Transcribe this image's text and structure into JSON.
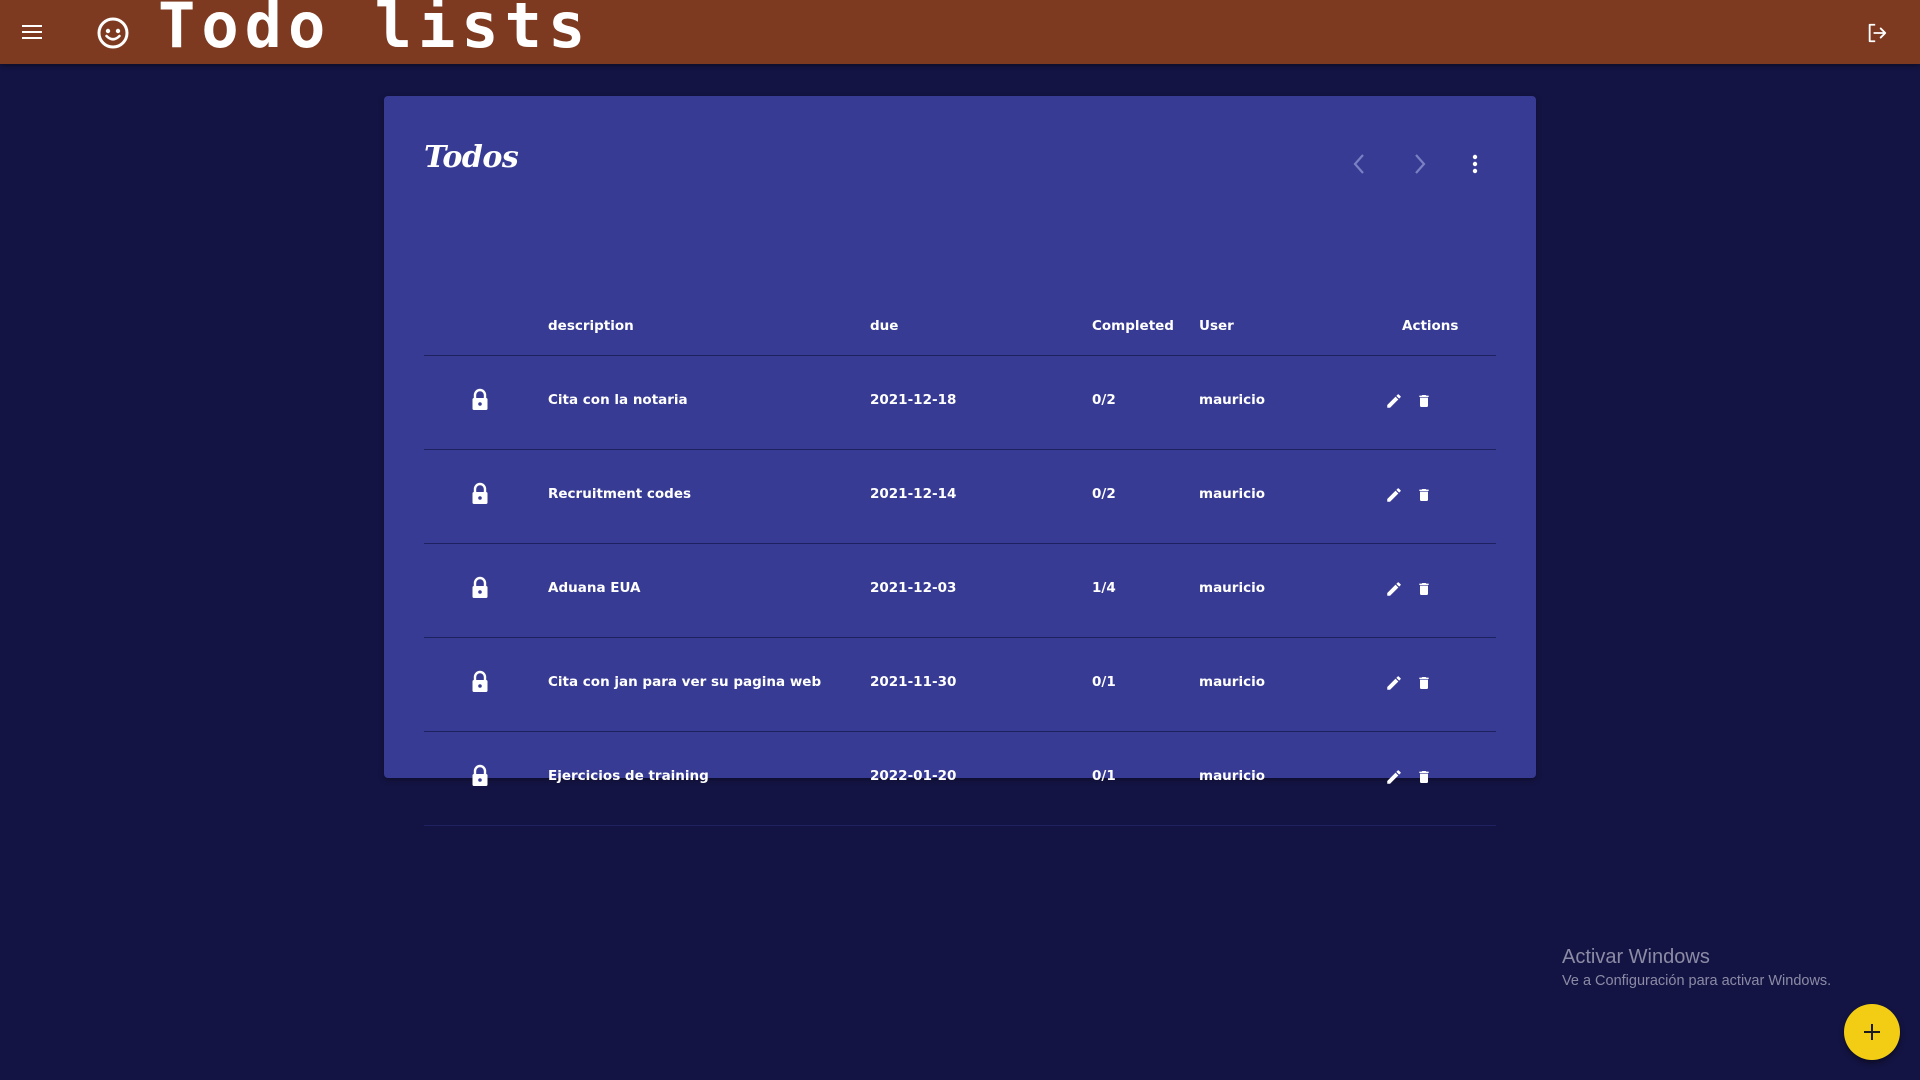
{
  "app": {
    "title": "Todo lists",
    "colors": {
      "topbar": "#7e3a21",
      "background": "#141444",
      "card": "#373b93",
      "fab": "#f2cd13"
    },
    "icons": {
      "menu": "menu-icon",
      "face": "face-icon",
      "logout": "logout-icon"
    }
  },
  "card": {
    "title": "Todos",
    "tools": {
      "prev": "chevron-left-icon",
      "next": "chevron-right-icon",
      "more": "more-vert-icon"
    }
  },
  "table": {
    "headers": {
      "description": "description",
      "due": "due",
      "completed": "Completed",
      "user": "User",
      "actions": "Actions"
    },
    "rows": [
      {
        "description": "Cita con la notaria",
        "due": "2021-12-18",
        "completed": "0/2",
        "user": "mauricio"
      },
      {
        "description": "Recruitment codes",
        "due": "2021-12-14",
        "completed": "0/2",
        "user": "mauricio"
      },
      {
        "description": "Aduana EUA",
        "due": "2021-12-03",
        "completed": "1/4",
        "user": "mauricio"
      },
      {
        "description": "Cita con jan para ver su pagina web",
        "due": "2021-11-30",
        "completed": "0/1",
        "user": "mauricio"
      },
      {
        "description": "Ejercicios de training",
        "due": "2022-01-20",
        "completed": "0/1",
        "user": "mauricio"
      }
    ]
  },
  "watermark": {
    "title": "Activar Windows",
    "subtitle": "Ve a Configuración para activar Windows."
  },
  "fab": {
    "icon": "plus-icon"
  }
}
